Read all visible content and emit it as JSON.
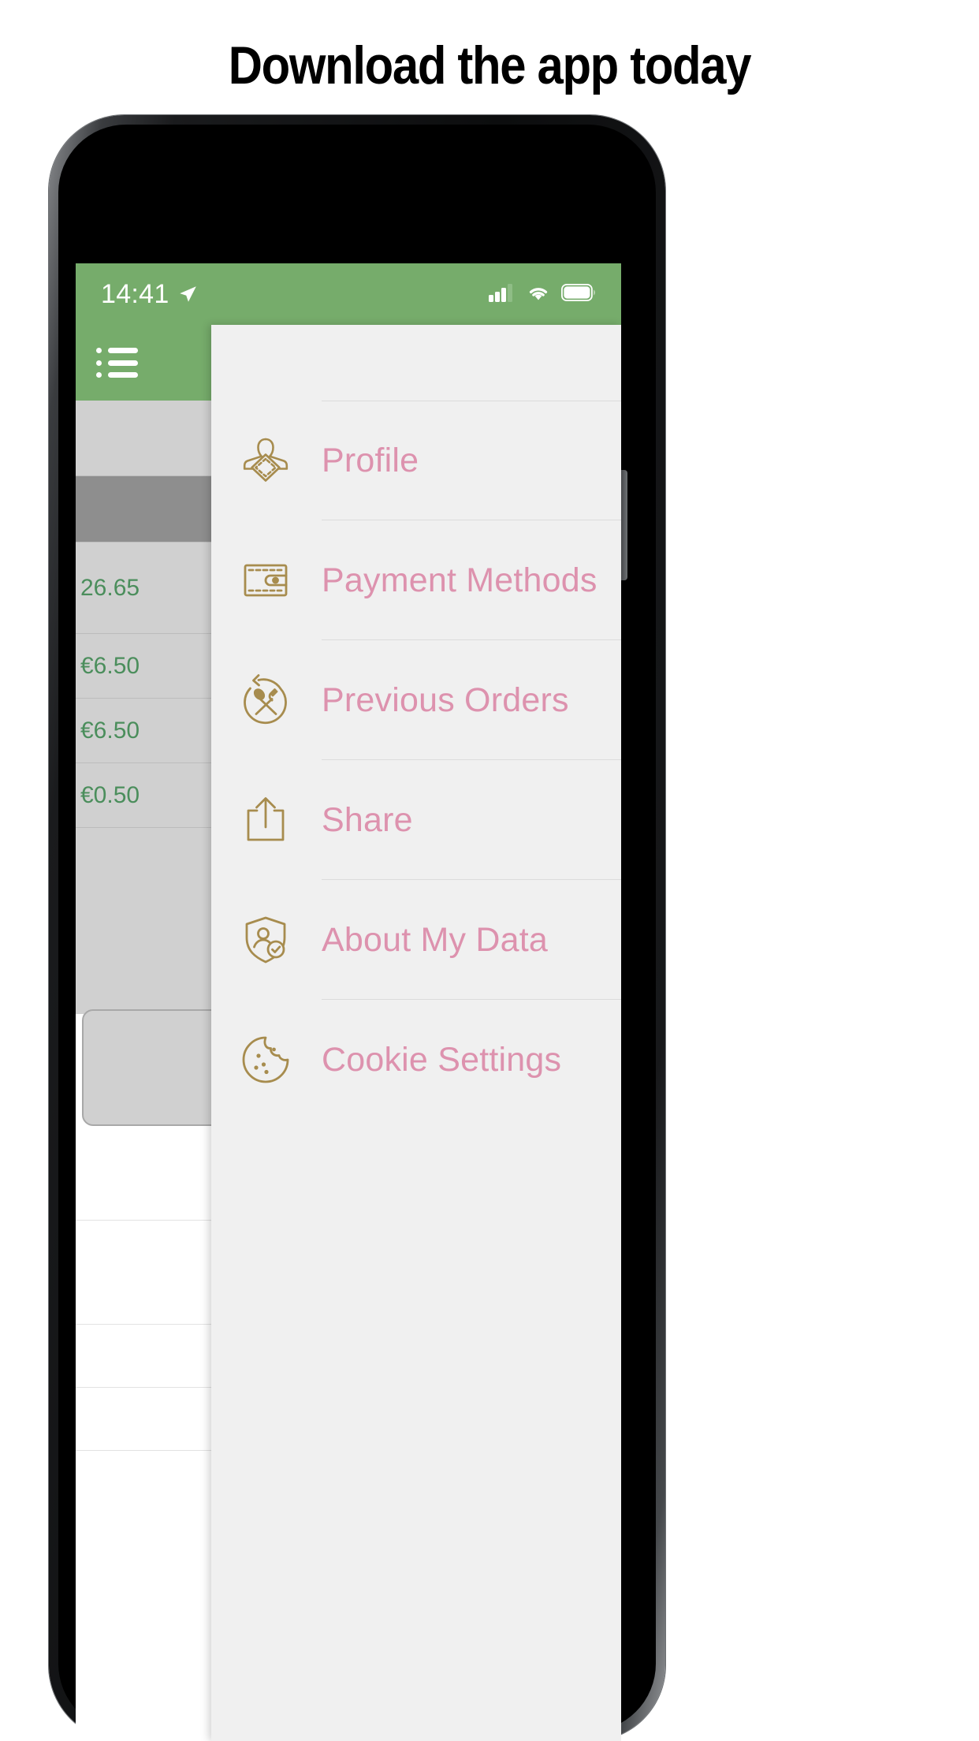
{
  "headline": "Download the app today",
  "colors": {
    "brand_green": "#76ac6b",
    "menu_text_pink": "#dd92ae",
    "menu_icon_gold": "#a78c4e",
    "drawer_bg": "#f0f0f0",
    "price_green": "#4b8e5c"
  },
  "statusbar": {
    "time": "14:41",
    "location_icon": "location-arrow-icon",
    "signal_icon": "cellular-signal-icon",
    "wifi_icon": "wifi-icon",
    "battery_icon": "battery-icon"
  },
  "navbar": {
    "menu_button_icon": "hamburger-list-icon"
  },
  "drawer": {
    "items": [
      {
        "label": "Profile",
        "icon": "profile-person-icon"
      },
      {
        "label": "Payment Methods",
        "icon": "wallet-icon"
      },
      {
        "label": "Previous Orders",
        "icon": "cutlery-refresh-icon"
      },
      {
        "label": "Share",
        "icon": "share-upload-icon"
      },
      {
        "label": "About My Data",
        "icon": "shield-person-check-icon"
      },
      {
        "label": "Cookie Settings",
        "icon": "cookie-icon"
      }
    ]
  },
  "background_app": {
    "prices": [
      "26.65",
      "€6.50",
      "€6.50",
      "€0.50"
    ]
  }
}
